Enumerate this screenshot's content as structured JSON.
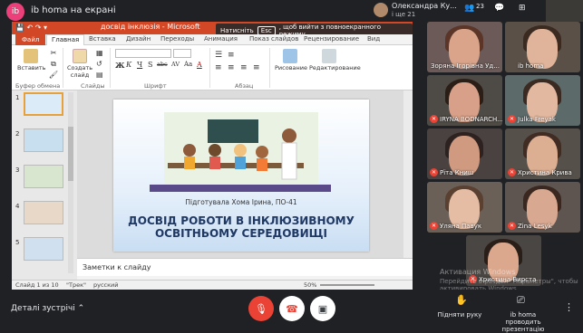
{
  "topbar": {
    "presenter_initials": "ib",
    "presenter_title": "ib homa на екрані",
    "me_name": "Олександра Ку...",
    "me_sub": "і ще 21",
    "people_count": "23",
    "chat_icon": "chat-icon",
    "activities_icon": "activities-icon"
  },
  "ppt": {
    "qat": "💾 ↶ ↷ ▾",
    "window_title": "досвід інклюзія - Microsoft",
    "esc_before": "Натисніть",
    "esc_key": "Esc",
    "esc_after": ", щоб вийти з повноекранного режиму",
    "tabs": [
      "Файл",
      "Главная",
      "Вставка",
      "Дизайн",
      "Переходы",
      "Анимация",
      "Показ слайдов",
      "Рецензирование",
      "Вид"
    ],
    "ribbon": {
      "paste": "Вставить",
      "create_slide": "Создать слайд",
      "clipboard_group": "Буфер обмена",
      "slides_group": "Слайды",
      "font_group": "Шрифт",
      "paragraph_group": "Абзац",
      "drawing": "Рисование",
      "editing": "Редактирование",
      "bold": "Ж",
      "italic": "К",
      "underline": "Ч",
      "strike": "S",
      "shadow": "abc",
      "spacing": "AV",
      "case": "Aa",
      "font_color": "A"
    },
    "thumb_numbers": [
      "1",
      "2",
      "3",
      "4",
      "5"
    ],
    "slide": {
      "caption": "Підготувала Хома Ірина, ПО-41",
      "heading_line1": "ДОСВІД РОБОТИ В ІНКЛЮЗИВНОМУ",
      "heading_line2": "ОСВІТНЬОМУ СЕРЕДОВИЩІ"
    },
    "notes_placeholder": "Заметки к слайду",
    "status": {
      "slide_of": "Слайд 1 из 10",
      "theme": "\"Трек\"",
      "language": "русский",
      "zoom": "50%"
    }
  },
  "participants": [
    {
      "name": "Зоряна Ігорівна Уд...",
      "muted": false
    },
    {
      "name": "ib homa",
      "muted": false
    },
    {
      "name": "IRYNA BODNARCH...",
      "muted": true
    },
    {
      "name": "Julka Freyak",
      "muted": true
    },
    {
      "name": "Рїта Книш",
      "muted": true
    },
    {
      "name": "Христина Крива",
      "muted": true
    },
    {
      "name": "Уляна Павук",
      "muted": true
    },
    {
      "name": "Zina Lesyk",
      "muted": true
    },
    {
      "name": "Христина Вирста",
      "muted": true
    }
  ],
  "watermark": {
    "line1": "Активация Windows",
    "line2": "Перейдите в раздел \"Параметры\", чтобы активировать Windows."
  },
  "bottombar": {
    "details": "Деталі зустрічі",
    "raise_hand": "Підняти руку",
    "presenting": "ib homa проводить презентацію"
  },
  "colors": {
    "ppt_accent": "#d24726",
    "meet_red": "#ea4335",
    "meet_bg": "#202124"
  }
}
